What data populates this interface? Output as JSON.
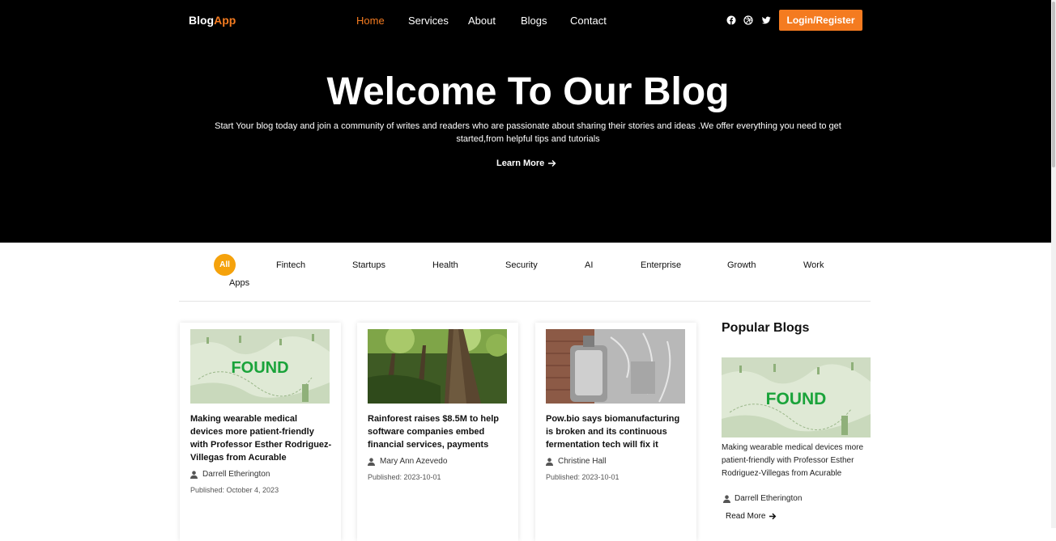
{
  "brand": {
    "part1": "Blog",
    "part2": "App"
  },
  "nav": {
    "items": [
      "Home",
      "Services",
      "About",
      "Blogs",
      "Contact"
    ],
    "active": "Home",
    "login_label": "Login/Register",
    "social_icons": [
      "facebook-icon",
      "dribbble-icon",
      "twitter-icon"
    ]
  },
  "hero": {
    "title": "Welcome To Our Blog",
    "lead": "Start Your blog today and join a community of writes and readers who are passionate about sharing their stories and ideas .We offer everything you need to get started,from helpful tips and tutorials",
    "cta": "Learn More"
  },
  "categories": [
    "All",
    "Fintech",
    "Startups",
    "Health",
    "Security",
    "AI",
    "Enterprise",
    "Growth",
    "Work",
    "Apps"
  ],
  "cards": [
    {
      "title": "Making wearable medical devices more patient-friendly with Professor Esther Rodriguez-Villegas from Acurable",
      "author": "Darrell Etherington",
      "date": "Published: October 4, 2023",
      "image": "found-image"
    },
    {
      "title": "Rainforest raises $8.5M to help software companies embed financial services, payments",
      "author": "Mary Ann Azevedo",
      "date": "Published: 2023-10-01",
      "image": "rainforest-image"
    },
    {
      "title": "Pow.bio says biomanufacturing is broken and its continuous fermentation tech will fix it",
      "author": "Christine Hall",
      "date": "Published: 2023-10-01",
      "image": "lab-image"
    }
  ],
  "popular": {
    "heading": "Popular Blogs",
    "title": "Making wearable medical devices more patient-friendly with Professor Esther Rodriguez-Villegas from Acurable",
    "author": "Darrell Etherington",
    "read_more": "Read More"
  },
  "image_text": {
    "found": "FOUND"
  },
  "colors": {
    "accent": "#f47b20",
    "all_pill": "#f5a20c",
    "hero_bg": "#000000"
  }
}
